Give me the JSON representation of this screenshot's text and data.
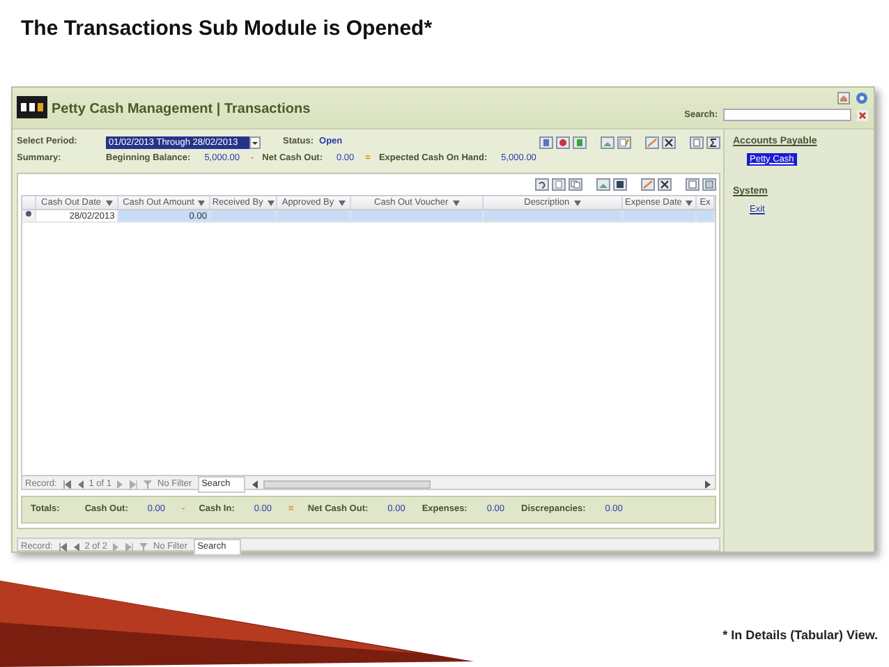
{
  "slide_title": "The Transactions Sub Module is Opened*",
  "window": {
    "title": "Petty Cash Management | Transactions"
  },
  "search": {
    "label": "Search:"
  },
  "period": {
    "label": "Select Period:",
    "value": "01/02/2013 Through 28/02/2013",
    "status_label": "Status:",
    "status": "Open"
  },
  "summary": {
    "label": "Summary:",
    "items": [
      {
        "kind": "amount",
        "label": "Beginning Balance:",
        "value": "5,000.00"
      },
      {
        "kind": "operator",
        "symbol": "-"
      },
      {
        "kind": "amount",
        "label": "Net Cash Out:",
        "value": "0.00"
      },
      {
        "kind": "operator",
        "symbol": "="
      },
      {
        "kind": "amount",
        "label": "Expected Cash On Hand:",
        "value": "5,000.00"
      }
    ]
  },
  "columns": [
    {
      "label": "Cash Out Date",
      "dropdown": true
    },
    {
      "label": "Cash Out Amount",
      "dropdown": true
    },
    {
      "label": "Received By",
      "dropdown": true
    },
    {
      "label": "Approved By",
      "dropdown": true
    },
    {
      "label": "Cash Out Voucher",
      "dropdown": true
    },
    {
      "label": "Description",
      "dropdown": true
    },
    {
      "label": "Expense Date",
      "dropdown": true
    },
    {
      "label": "Ex",
      "dropdown": false
    }
  ],
  "rows": [
    {
      "selected": true,
      "cash_out_date": "28/02/2013",
      "cash_out_amount": "0.00"
    }
  ],
  "subform_nav": {
    "label": "Record:",
    "position": "1 of 1",
    "filter": "No Filter",
    "search": "Search"
  },
  "totals": {
    "label": "Totals:",
    "items": [
      {
        "kind": "amount",
        "label": "Cash Out:",
        "value": "0.00"
      },
      {
        "kind": "operator",
        "symbol": "-"
      },
      {
        "kind": "amount",
        "label": "Cash In:",
        "value": "0.00"
      },
      {
        "kind": "operator",
        "symbol": "="
      },
      {
        "kind": "amount",
        "label": "Net Cash Out:",
        "value": "0.00"
      },
      {
        "kind": "amount",
        "label": "Expenses:",
        "value": "0.00"
      },
      {
        "kind": "amount",
        "label": "Discrepancies:",
        "value": "0.00"
      }
    ]
  },
  "form_nav": {
    "label": "Record:",
    "position": "2 of 2",
    "filter": "No Filter",
    "search": "Search"
  },
  "sidebar": {
    "groups": [
      {
        "title": "Accounts Payable",
        "items": [
          {
            "label": "Petty Cash",
            "selected": true
          }
        ]
      },
      {
        "title": "System",
        "items": [
          {
            "label": "Exit",
            "selected": false
          }
        ]
      }
    ]
  },
  "footnote": "* In Details (Tabular) View."
}
